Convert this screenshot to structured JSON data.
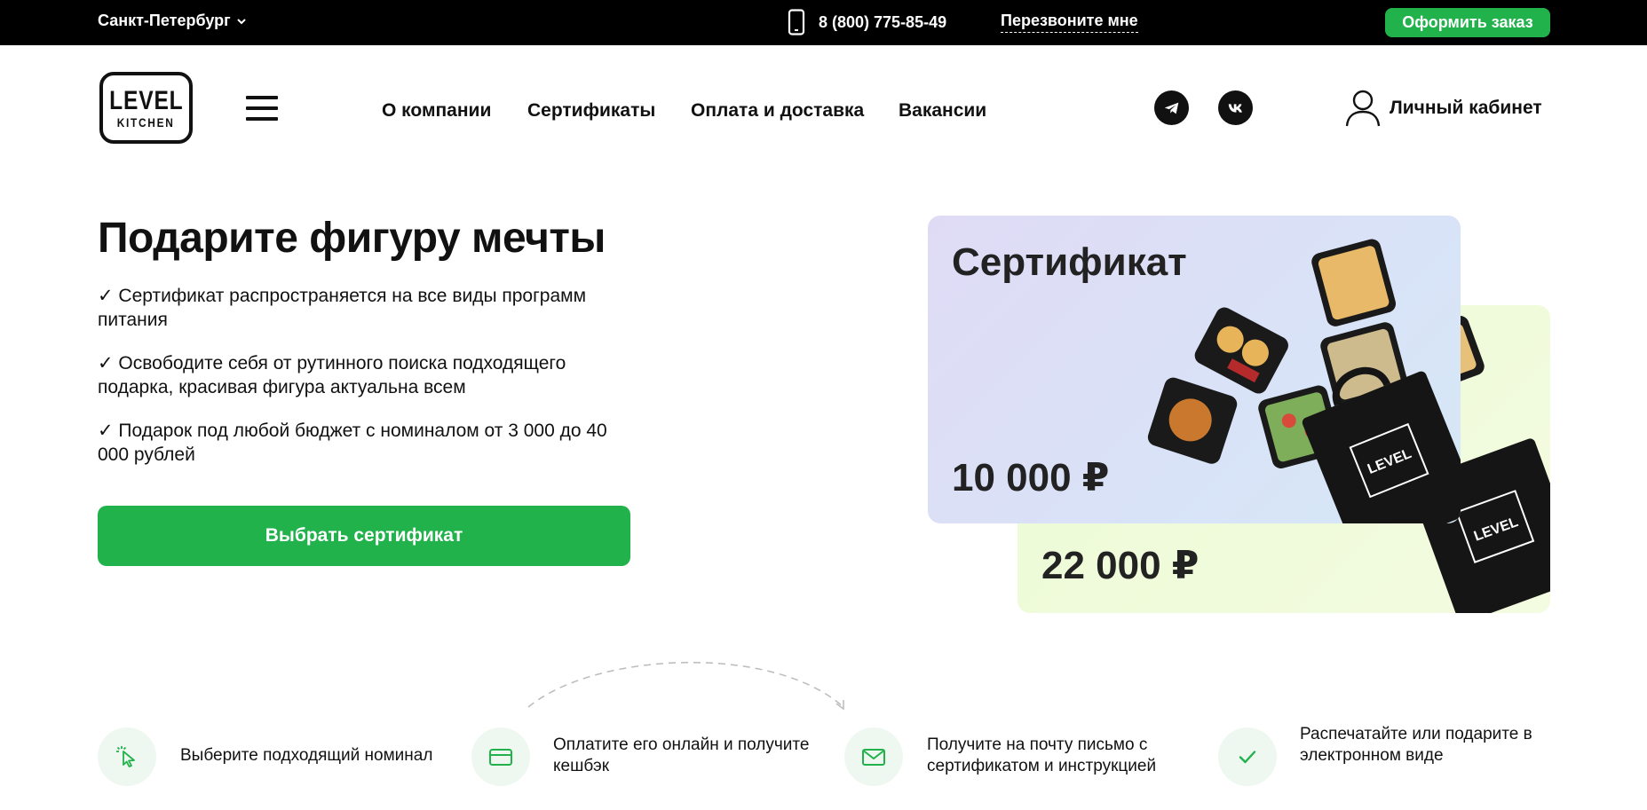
{
  "topbar": {
    "city": "Санкт-Петербург",
    "phone": "8 (800) 775-85-49",
    "callback": "Перезвоните мне",
    "order_button": "Оформить заказ"
  },
  "header": {
    "logo_line1": "LEVEL",
    "logo_line2": "KITCHEN",
    "nav": [
      "О компании",
      "Сертификаты",
      "Оплата и доставка",
      "Вакансии"
    ],
    "cabinet": "Личный кабинет"
  },
  "hero": {
    "title": "Подарите фигуру мечты",
    "benefits": [
      "✓ Сертификат распространяется на все виды программ питания",
      "✓ Освободите себя от рутинного поиска подходящего подарка, красивая фигура актуальна всем",
      "✓ Подарок под любой бюджет с номиналом от 3 000 до 40 000 рублей"
    ],
    "button": "Выбрать сертификат"
  },
  "cards": {
    "front_title": "Сертификат",
    "front_value": "10 000 ₽",
    "back_value": "22 000 ₽"
  },
  "steps": [
    {
      "text": "Выберите подходящий номинал",
      "icon": "cursor-click-icon"
    },
    {
      "text": "Оплатите его онлайн и получите кешбэк",
      "icon": "credit-card-icon"
    },
    {
      "text": "Получите на почту письмо с сертификатом и инструкцией",
      "icon": "envelope-icon"
    },
    {
      "text": "Распечатайте или подарите в электронном виде",
      "icon": "check-icon"
    }
  ],
  "colors": {
    "accent": "#22b24c",
    "topbar": "#000000",
    "step_icon_bg": "#eef8f0"
  }
}
